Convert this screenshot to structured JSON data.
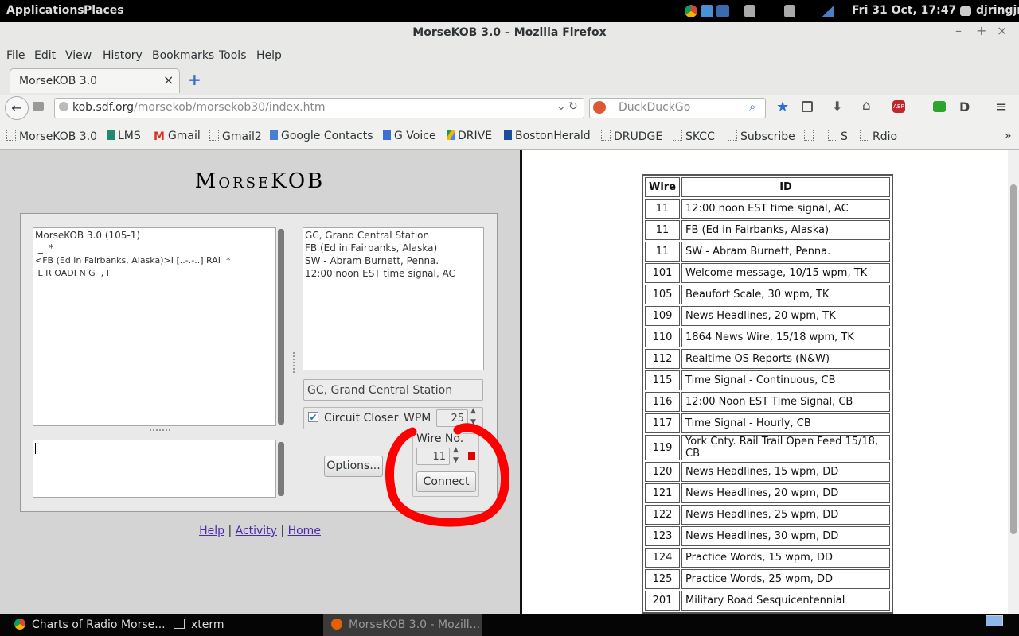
{
  "top_panel": {
    "applications": "Applications",
    "places": "Places",
    "clock": "Fri 31 Oct, 17:47",
    "user": "djringjr"
  },
  "window": {
    "title": "MorseKOB 3.0 – Mozilla Firefox",
    "minimize": "–",
    "maximize": "+",
    "close": "×"
  },
  "menubar": [
    "File",
    "Edit",
    "View",
    "History",
    "Bookmarks",
    "Tools",
    "Help"
  ],
  "tab": {
    "title": "MorseKOB 3.0",
    "close": "×",
    "new_tab": "+"
  },
  "navbar": {
    "url_host": "kob.sdf.org",
    "url_path": "/morsekob/morsekob30/index.htm",
    "search_placeholder": "DuckDuckGo"
  },
  "bookmarks": [
    "MorseKOB 3.0",
    "LMS",
    "Gmail",
    "Gmail2",
    "Google Contacts",
    "G Voice",
    "DRIVE",
    "BostonHerald",
    "DRUDGE",
    "SKCC",
    "Subscribe",
    "",
    "S",
    "Rdio"
  ],
  "bookmarks_overflow": "»",
  "applet": {
    "logo": "MorseKOB",
    "log_lines": [
      "MorseKOB 3.0 (105-1)",
      " _  *",
      "<FB (Ed in Fairbanks, Alaska)>I [..-.-..] RAI  *",
      " L R OADI N G  , I"
    ],
    "stations": [
      "GC, Grand Central Station",
      "FB (Ed in Fairbanks, Alaska)",
      "SW - Abram Burnett, Penna.",
      "12:00 noon EST time signal, AC"
    ],
    "office_field": "GC, Grand Central Station",
    "circuit_closer_label": "Circuit Closer",
    "circuit_closer_checked": true,
    "wpm_label": "WPM",
    "wpm_value": "25",
    "wire_no_label": "Wire No.",
    "wire_no_value": "11",
    "options_button": "Options...",
    "connect_button": "Connect",
    "status_color": "#e00000",
    "annotation_color": "#ff0000"
  },
  "footer_links": {
    "help": "Help",
    "activity": "Activity",
    "home": "Home",
    "sep": "|"
  },
  "wire_table": {
    "headers": [
      "Wire",
      "ID"
    ],
    "rows": [
      [
        "11",
        "12:00 noon EST time signal, AC"
      ],
      [
        "11",
        "FB (Ed in Fairbanks, Alaska)"
      ],
      [
        "11",
        "SW - Abram Burnett, Penna."
      ],
      [
        "101",
        "Welcome message, 10/15 wpm, TK"
      ],
      [
        "105",
        "Beaufort Scale, 30 wpm, TK"
      ],
      [
        "109",
        "News Headlines, 20 wpm, TK"
      ],
      [
        "110",
        "1864 News Wire, 15/18 wpm, TK"
      ],
      [
        "112",
        "Realtime OS Reports (N&W)"
      ],
      [
        "115",
        "Time Signal - Continuous, CB"
      ],
      [
        "116",
        "12:00 Noon EST Time Signal, CB"
      ],
      [
        "117",
        "Time Signal - Hourly, CB"
      ],
      [
        "119",
        "York Cnty. Rail Trail Open Feed 15/18, CB"
      ],
      [
        "120",
        "News Headlines, 15 wpm, DD"
      ],
      [
        "121",
        "News Headlines, 20 wpm, DD"
      ],
      [
        "122",
        "News Headlines, 25 wpm, DD"
      ],
      [
        "123",
        "News Headlines, 30 wpm, DD"
      ],
      [
        "124",
        "Practice Words, 15 wpm, DD"
      ],
      [
        "125",
        "Practice Words, 25 wpm, DD"
      ],
      [
        "201",
        "Military Road Sesquicentennial"
      ]
    ]
  },
  "taskbar": [
    "Charts of Radio Morse...",
    "xterm",
    "MorseKOB 3.0 - Mozill..."
  ]
}
